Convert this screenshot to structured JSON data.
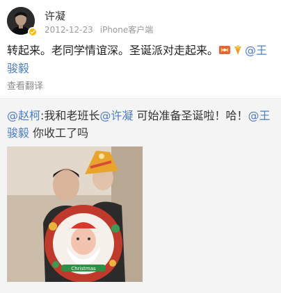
{
  "post": {
    "author": "许凝",
    "date": "2012-12-23",
    "source": "iPhone客户端",
    "text_before": "转起来。老同学情谊深。圣诞派对走起来。",
    "mention_at": "@王骏毅",
    "translate": "查看翻译"
  },
  "repost": {
    "mention1": "@赵柯",
    "text1": ":我和老班长",
    "mention2": "@许凝",
    "text2": " 可始准备圣诞啦！哈！",
    "mention3": "@王骏毅",
    "text3": " 你收工了吗",
    "photo_caption": "Christmas"
  },
  "icons": {
    "verified": "verified-badge-icon",
    "emoji1": "ribbon-emoji-icon",
    "emoji2": "bell-emoji-icon"
  },
  "colors": {
    "link": "#4a7cc9",
    "badge": "#ffb800",
    "repost_bg": "#f4f4f4"
  }
}
